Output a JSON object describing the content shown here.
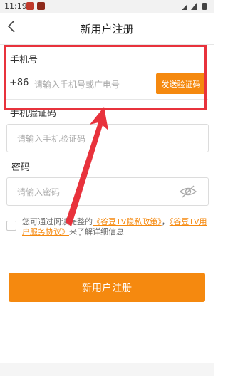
{
  "status_bar": {
    "time": "11:19",
    "app_icon_colors": [
      "#c0392b",
      "#8e2a1c"
    ]
  },
  "header": {
    "back_icon": "chevron-left-icon",
    "title": "新用户注册"
  },
  "phone": {
    "label": "手机号",
    "country_code": "+86",
    "placeholder": "请输入手机号或广电号",
    "send_code_label": "发送验证码"
  },
  "code": {
    "label": "手机验证码",
    "placeholder": "请输入手机验证码"
  },
  "password": {
    "label": "密码",
    "placeholder": "请输入密码",
    "toggle_icon": "eye-off-icon"
  },
  "agreement": {
    "checked": false,
    "prefix": "您可通过阅读完整的",
    "privacy_link": "《谷豆TV隐私政策》",
    "separator": "，",
    "terms_link": "《谷豆TV用户服务协议》",
    "suffix": "来了解详细信息"
  },
  "register_button": "新用户注册",
  "colors": {
    "accent": "#f5890f",
    "annotation": "#e8323c"
  }
}
